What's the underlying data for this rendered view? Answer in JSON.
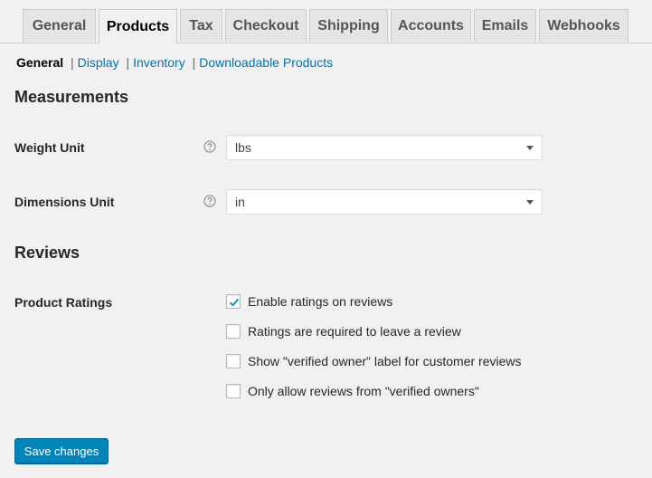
{
  "tabs": [
    {
      "label": "General"
    },
    {
      "label": "Products"
    },
    {
      "label": "Tax"
    },
    {
      "label": "Checkout"
    },
    {
      "label": "Shipping"
    },
    {
      "label": "Accounts"
    },
    {
      "label": "Emails"
    },
    {
      "label": "Webhooks"
    }
  ],
  "active_tab": "Products",
  "subnav": {
    "current": "General",
    "links": [
      "Display",
      "Inventory",
      "Downloadable Products"
    ],
    "separator": "|"
  },
  "measurements": {
    "heading": "Measurements",
    "weight_label": "Weight Unit",
    "weight_value": "lbs",
    "dimensions_label": "Dimensions Unit",
    "dimensions_value": "in"
  },
  "reviews": {
    "heading": "Reviews",
    "ratings_label": "Product Ratings",
    "options": [
      {
        "label": "Enable ratings on reviews",
        "checked": true
      },
      {
        "label": "Ratings are required to leave a review",
        "checked": false
      },
      {
        "label": "Show \"verified owner\" label for customer reviews",
        "checked": false
      },
      {
        "label": "Only allow reviews from \"verified owners\"",
        "checked": false
      }
    ]
  },
  "save_label": "Save changes",
  "colors": {
    "link": "#0073aa",
    "primary_button": "#0085ba"
  }
}
